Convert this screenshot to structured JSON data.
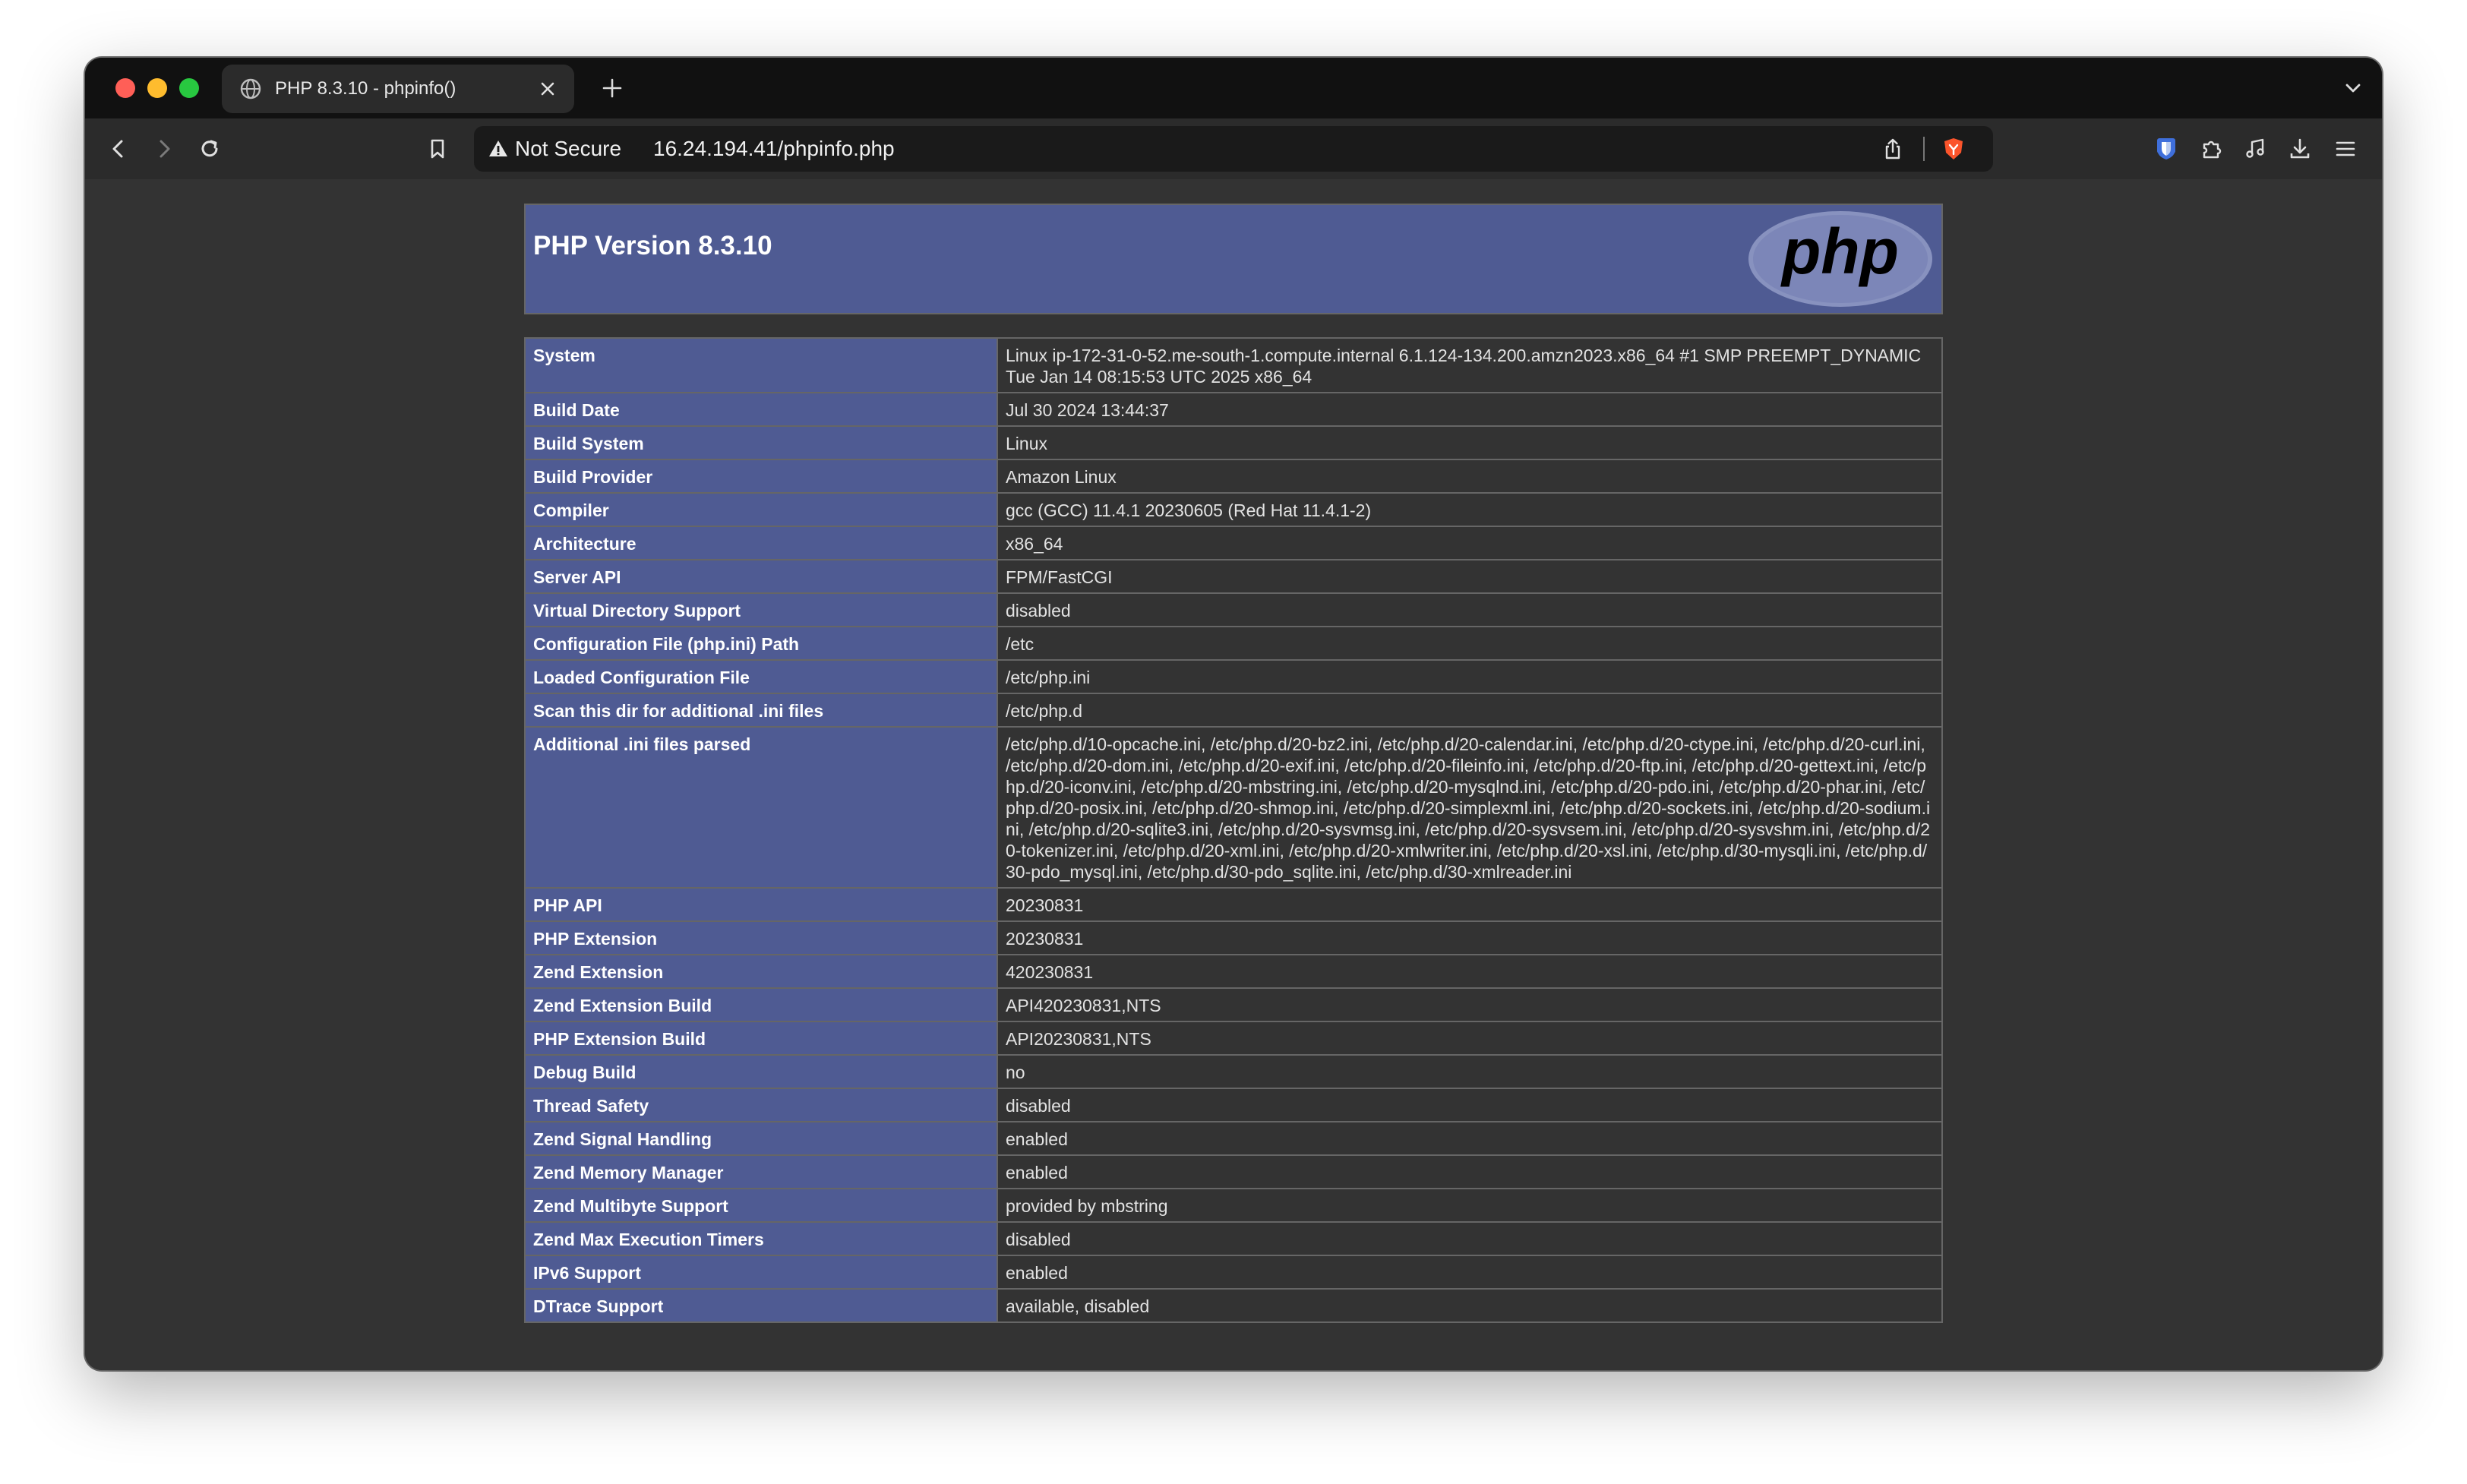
{
  "browser": {
    "tab": {
      "title": "PHP 8.3.10 - phpinfo()",
      "favicon": "globe-icon"
    },
    "address_bar": {
      "security_label": "Not Secure",
      "url": "16.24.194.41/phpinfo.php"
    },
    "colors": {
      "traffic_red": "#ff5f57",
      "traffic_yellow": "#febc2e",
      "traffic_green": "#28c840",
      "brave_orange": "#fb542b",
      "bitwarden_blue": "#3f6fdb"
    }
  },
  "page": {
    "header": {
      "title": "PHP Version 8.3.10",
      "logo_text": "php"
    },
    "colors": {
      "header_bg": "#4f5b93",
      "label_bg": "#4f5b93",
      "value_bg": "#333333",
      "page_bg": "#333333"
    },
    "rows": [
      {
        "label": "System",
        "value": "Linux ip-172-31-0-52.me-south-1.compute.internal 6.1.124-134.200.amzn2023.x86_64 #1 SMP PREEMPT_DYNAMIC Tue Jan 14 08:15:53 UTC 2025 x86_64"
      },
      {
        "label": "Build Date",
        "value": "Jul 30 2024 13:44:37"
      },
      {
        "label": "Build System",
        "value": "Linux"
      },
      {
        "label": "Build Provider",
        "value": "Amazon Linux"
      },
      {
        "label": "Compiler",
        "value": "gcc (GCC) 11.4.1 20230605 (Red Hat 11.4.1-2)"
      },
      {
        "label": "Architecture",
        "value": "x86_64"
      },
      {
        "label": "Server API",
        "value": "FPM/FastCGI"
      },
      {
        "label": "Virtual Directory Support",
        "value": "disabled"
      },
      {
        "label": "Configuration File (php.ini) Path",
        "value": "/etc"
      },
      {
        "label": "Loaded Configuration File",
        "value": "/etc/php.ini"
      },
      {
        "label": "Scan this dir for additional .ini files",
        "value": "/etc/php.d"
      },
      {
        "label": "Additional .ini files parsed",
        "value": "/etc/php.d/10-opcache.ini, /etc/php.d/20-bz2.ini, /etc/php.d/20-calendar.ini, /etc/php.d/20-ctype.ini, /etc/php.d/20-curl.ini, /etc/php.d/20-dom.ini, /etc/php.d/20-exif.ini, /etc/php.d/20-fileinfo.ini, /etc/php.d/20-ftp.ini, /etc/php.d/20-gettext.ini, /etc/php.d/20-iconv.ini, /etc/php.d/20-mbstring.ini, /etc/php.d/20-mysqlnd.ini, /etc/php.d/20-pdo.ini, /etc/php.d/20-phar.ini, /etc/php.d/20-posix.ini, /etc/php.d/20-shmop.ini, /etc/php.d/20-simplexml.ini, /etc/php.d/20-sockets.ini, /etc/php.d/20-sodium.ini, /etc/php.d/20-sqlite3.ini, /etc/php.d/20-sysvmsg.ini, /etc/php.d/20-sysvsem.ini, /etc/php.d/20-sysvshm.ini, /etc/php.d/20-tokenizer.ini, /etc/php.d/20-xml.ini, /etc/php.d/20-xmlwriter.ini, /etc/php.d/20-xsl.ini, /etc/php.d/30-mysqli.ini, /etc/php.d/30-pdo_mysql.ini, /etc/php.d/30-pdo_sqlite.ini, /etc/php.d/30-xmlreader.ini"
      },
      {
        "label": "PHP API",
        "value": "20230831"
      },
      {
        "label": "PHP Extension",
        "value": "20230831"
      },
      {
        "label": "Zend Extension",
        "value": "420230831"
      },
      {
        "label": "Zend Extension Build",
        "value": "API420230831,NTS"
      },
      {
        "label": "PHP Extension Build",
        "value": "API20230831,NTS"
      },
      {
        "label": "Debug Build",
        "value": "no"
      },
      {
        "label": "Thread Safety",
        "value": "disabled"
      },
      {
        "label": "Zend Signal Handling",
        "value": "enabled"
      },
      {
        "label": "Zend Memory Manager",
        "value": "enabled"
      },
      {
        "label": "Zend Multibyte Support",
        "value": "provided by mbstring"
      },
      {
        "label": "Zend Max Execution Timers",
        "value": "disabled"
      },
      {
        "label": "IPv6 Support",
        "value": "enabled"
      },
      {
        "label": "DTrace Support",
        "value": "available, disabled"
      }
    ]
  }
}
